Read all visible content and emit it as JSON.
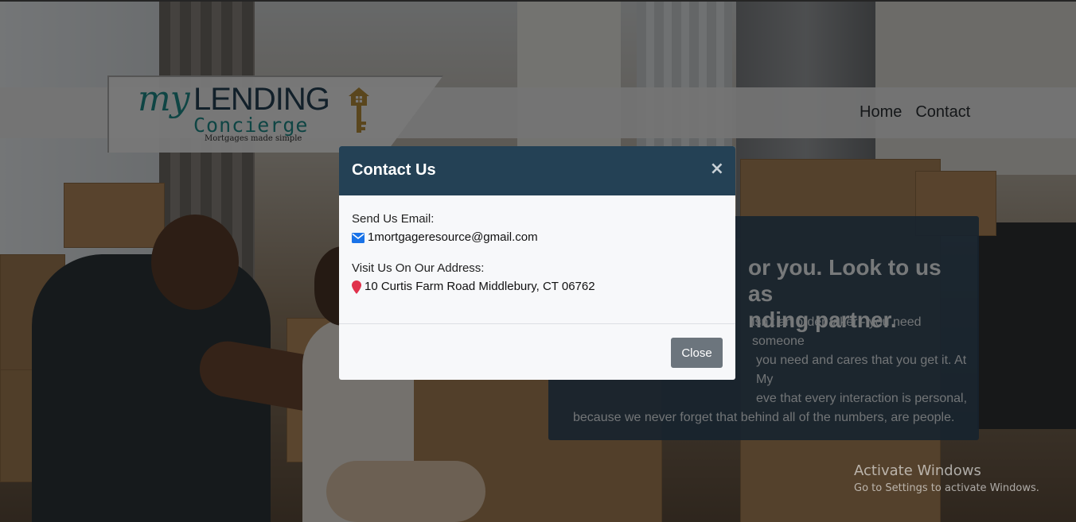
{
  "header": {
    "logo": {
      "my": "my",
      "lending": "LENDING",
      "concierge": "Concierge",
      "tagline": "Mortgages made simple"
    },
    "nav": [
      {
        "label": "Home"
      },
      {
        "label": "Contact"
      }
    ]
  },
  "hero": {
    "title_line1": "or you. Look to us as",
    "title_line2": "nding partner.",
    "text_line1": "isn’t an order taker - you need someone",
    "text_line2": "you need and cares that you get it. At My",
    "text_line3": "eve that every interaction is personal,",
    "text_line4": "because we never forget that behind all of the numbers, are people."
  },
  "modal": {
    "title": "Contact Us",
    "close_x": "×",
    "email_label": "Send Us Email:",
    "email_value": "1mortgageresource@gmail.com",
    "address_label": "Visit Us On Our Address:",
    "address_value": "10 Curtis Farm Road Middlebury, CT 06762",
    "close_button": "Close",
    "icons": {
      "email": "envelope-icon",
      "address": "map-marker-icon"
    },
    "colors": {
      "header": "#244155",
      "button": "#6c757d",
      "envelope": "#1a73e8",
      "marker": "#e0314b"
    }
  },
  "watermark": {
    "title": "Activate Windows",
    "subtitle": "Go to Settings to activate Windows."
  }
}
